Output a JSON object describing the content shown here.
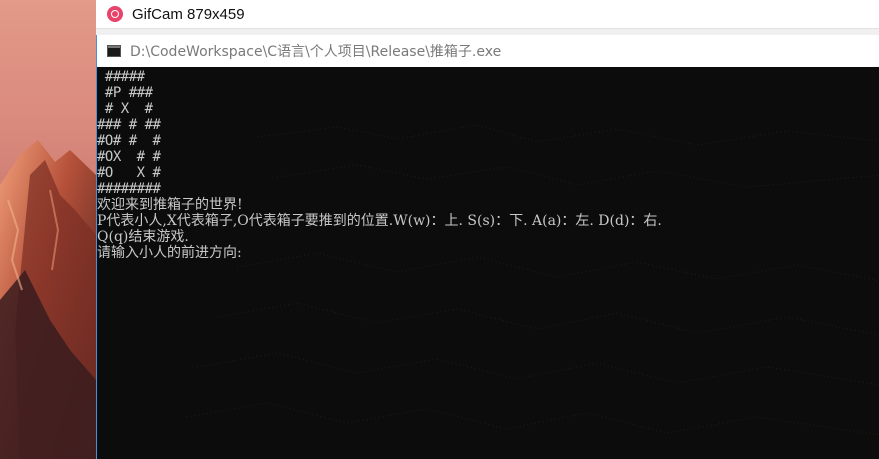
{
  "gifcam": {
    "title": "GifCam 879x459",
    "icon": "record-icon",
    "accent": "#e8436a"
  },
  "console": {
    "title": "D:\\CodeWorkspace\\C语言\\个人项目\\Release\\推箱子.exe",
    "icon": "console-icon",
    "background": "#0c0c0c",
    "foreground": "#c8c8c8",
    "map_lines": [
      " #####",
      " #P ###",
      " # X  #",
      "### # ##",
      "#O# #  #",
      "#OX  # #",
      "#O   X #",
      "########"
    ],
    "messages": [
      "欢迎来到推箱子的世界!",
      "P代表小人,X代表箱子,O代表箱子要推到的位置.W(w)：上. S(s)：下. A(a)：左. D(d)：右.",
      "Q(q)结束游戏.",
      "请输入小人的前进方向:"
    ]
  },
  "desktop": {
    "wallpaper": "mountain-sunset-wallpaper"
  }
}
